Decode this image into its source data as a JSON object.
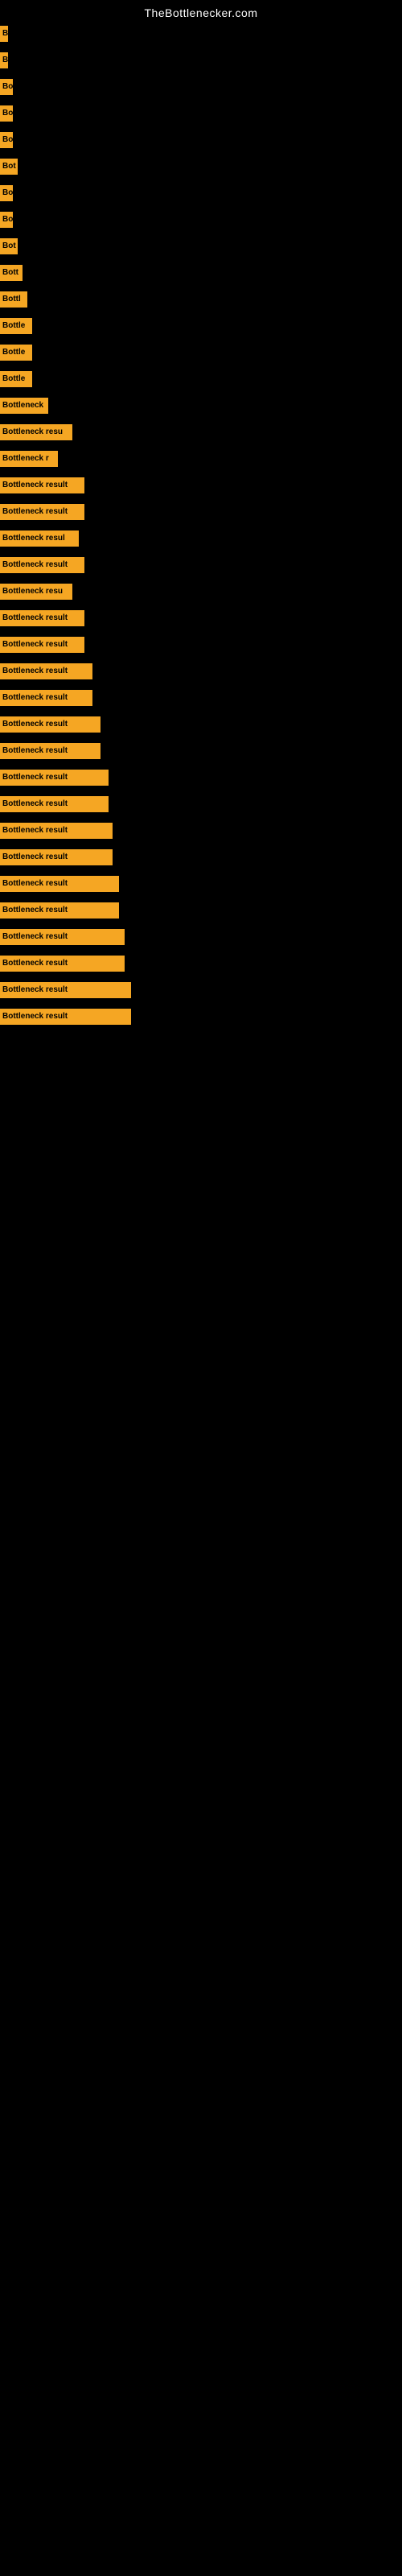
{
  "site": {
    "title": "TheBottlenecker.com"
  },
  "bars": [
    {
      "label": "B",
      "width": 10
    },
    {
      "label": "B",
      "width": 10
    },
    {
      "label": "Bo",
      "width": 16
    },
    {
      "label": "Bo",
      "width": 16
    },
    {
      "label": "Bo",
      "width": 16
    },
    {
      "label": "Bot",
      "width": 22
    },
    {
      "label": "Bo",
      "width": 16
    },
    {
      "label": "Bo",
      "width": 16
    },
    {
      "label": "Bot",
      "width": 22
    },
    {
      "label": "Bott",
      "width": 28
    },
    {
      "label": "Bottl",
      "width": 34
    },
    {
      "label": "Bottle",
      "width": 40
    },
    {
      "label": "Bottle",
      "width": 40
    },
    {
      "label": "Bottle",
      "width": 40
    },
    {
      "label": "Bottleneck",
      "width": 60
    },
    {
      "label": "Bottleneck resu",
      "width": 90
    },
    {
      "label": "Bottleneck r",
      "width": 72
    },
    {
      "label": "Bottleneck result",
      "width": 105
    },
    {
      "label": "Bottleneck result",
      "width": 105
    },
    {
      "label": "Bottleneck resul",
      "width": 98
    },
    {
      "label": "Bottleneck result",
      "width": 105
    },
    {
      "label": "Bottleneck resu",
      "width": 90
    },
    {
      "label": "Bottleneck result",
      "width": 105
    },
    {
      "label": "Bottleneck result",
      "width": 105
    },
    {
      "label": "Bottleneck result",
      "width": 115
    },
    {
      "label": "Bottleneck result",
      "width": 115
    },
    {
      "label": "Bottleneck result",
      "width": 125
    },
    {
      "label": "Bottleneck result",
      "width": 125
    },
    {
      "label": "Bottleneck result",
      "width": 135
    },
    {
      "label": "Bottleneck result",
      "width": 135
    },
    {
      "label": "Bottleneck result",
      "width": 140
    },
    {
      "label": "Bottleneck result",
      "width": 140
    },
    {
      "label": "Bottleneck result",
      "width": 148
    },
    {
      "label": "Bottleneck result",
      "width": 148
    },
    {
      "label": "Bottleneck result",
      "width": 155
    },
    {
      "label": "Bottleneck result",
      "width": 155
    },
    {
      "label": "Bottleneck result",
      "width": 163
    },
    {
      "label": "Bottleneck result",
      "width": 163
    }
  ]
}
